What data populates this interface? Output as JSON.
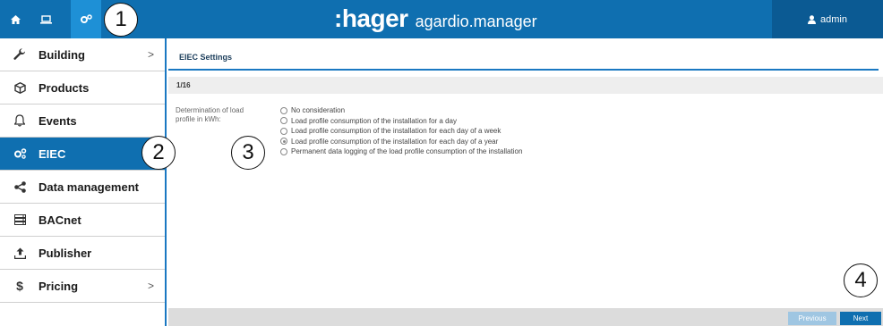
{
  "topbar": {
    "icons": [
      "home-icon",
      "laptop-icon",
      "gears-icon"
    ],
    "brand_logo": ":hager",
    "brand_app": "agardio.manager",
    "user_label": "admin",
    "user_icon": "user-icon"
  },
  "sidebar": {
    "items": [
      {
        "label": "Building",
        "icon": "wrench-icon",
        "chevron": ">"
      },
      {
        "label": "Products",
        "icon": "cube-icon"
      },
      {
        "label": "Events",
        "icon": "bell-icon"
      },
      {
        "label": "EIEC",
        "icon": "gears-icon"
      },
      {
        "label": "Data management",
        "icon": "share-icon"
      },
      {
        "label": "BACnet",
        "icon": "server-icon"
      },
      {
        "label": "Publisher",
        "icon": "upload-icon"
      },
      {
        "label": "Pricing",
        "icon": "dollar-icon",
        "chevron": ">"
      }
    ]
  },
  "main": {
    "title": "EIEC Settings",
    "step": "1/16",
    "field_label": "Determination of load profile in kWh:",
    "options": [
      "No consideration",
      "Load profile consumption of the installation for a day",
      "Load profile consumption of the installation for each day of a week",
      "Load profile consumption of the installation for each day of a year",
      "Permanent data logging of the load profile consumption of the installation"
    ],
    "selected_option": "Load profile consumption of the installation for each day of a year",
    "prev_label": "Previous",
    "next_label": "Next"
  },
  "callouts": [
    "1",
    "2",
    "3",
    "4"
  ],
  "colors": {
    "topbar": "#0f6fb0",
    "active_tab": "#1e90d6",
    "user_area": "#0b5a93",
    "accent": "#1a78c2",
    "prev_button": "#9fc6e2"
  }
}
